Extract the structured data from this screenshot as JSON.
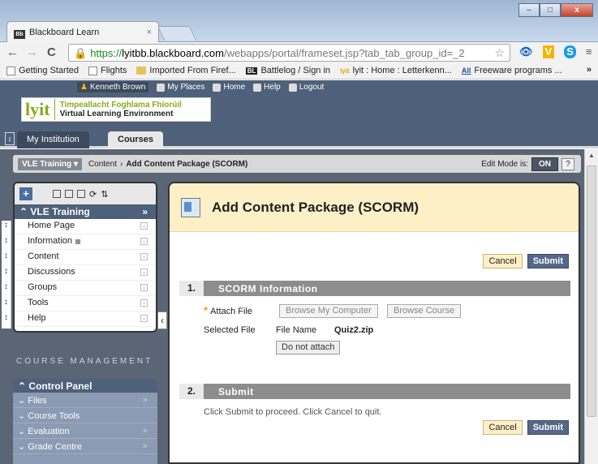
{
  "browser": {
    "tab_title": "Blackboard Learn",
    "tab_favicon": "Bb",
    "url_https": "https://",
    "url_host": "lyitbb.blackboard.com",
    "url_path": "/webapps/portal/frameset.jsp?tab_tab_group_id=_2",
    "bookmarks": [
      {
        "label": "Getting Started",
        "icon": "page-icon"
      },
      {
        "label": "Flights",
        "icon": "page-icon"
      },
      {
        "label": "Imported From Firef...",
        "icon": "folder-icon"
      },
      {
        "label": "Battlelog / Sign in",
        "icon": "BL"
      },
      {
        "label": "lyit : Home : Letterkenn...",
        "icon": "lyit"
      },
      {
        "label": "Freeware programs ...",
        "icon": "All"
      }
    ],
    "more_bookmarks": "»"
  },
  "header": {
    "logo_mark": "lyit",
    "logo_line1": "Timpeallacht Foghlama Fhíorúil",
    "logo_line2": "Virtual Learning Environment",
    "user": "Kenneth Brown",
    "links": [
      "My Places",
      "Home",
      "Help",
      "Logout"
    ],
    "tabs": [
      "My Institution",
      "Courses"
    ]
  },
  "breadcrumb": {
    "course": "VLE Training",
    "path1": "Content",
    "sep": "›",
    "path2": "Add Content Package (SCORM)",
    "edit_mode_label": "Edit Mode is:",
    "edit_mode_value": "ON",
    "help": "?"
  },
  "course_menu": {
    "title": "VLE Training",
    "items": [
      "Home Page",
      "Information",
      "Content",
      "Discussions",
      "Groups",
      "Tools",
      "Help"
    ]
  },
  "course_management": {
    "label": "COURSE MANAGEMENT",
    "panel_title": "Control Panel",
    "items": [
      "Files",
      "Course Tools",
      "Evaluation",
      "Grade Centre"
    ]
  },
  "page": {
    "title": "Add Content Package (SCORM)",
    "cancel": "Cancel",
    "submit": "Submit",
    "section1_num": "1.",
    "section1_title": "SCORM Information",
    "attach_label": "Attach File",
    "browse_computer": "Browse My Computer",
    "browse_course": "Browse Course",
    "selected_label": "Selected File",
    "file_name_label": "File Name",
    "file_name_value": "Quiz2.zip",
    "do_not_attach": "Do not attach",
    "section2_num": "2.",
    "section2_title": "Submit",
    "submit_instructions": "Click Submit to proceed. Click Cancel to quit."
  }
}
